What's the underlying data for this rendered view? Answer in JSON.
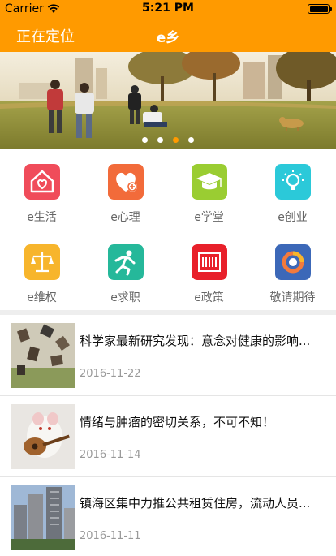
{
  "status_bar": {
    "carrier": "Carrier",
    "time": "5:21 PM",
    "battery_level": 1.0
  },
  "nav": {
    "location_label": "正在定位",
    "title": "e乡"
  },
  "banner": {
    "slide_count": 4,
    "active_slide": 2
  },
  "grid": {
    "items": [
      {
        "label": "e生活",
        "icon": "home-heart-icon",
        "color": "#F04C5A"
      },
      {
        "label": "e心理",
        "icon": "heart-plus-icon",
        "color": "#F26B3A"
      },
      {
        "label": "e学堂",
        "icon": "graduation-cap-icon",
        "color": "#9ACD32"
      },
      {
        "label": "e创业",
        "icon": "lightbulb-icon",
        "color": "#2BC9D9"
      },
      {
        "label": "e维权",
        "icon": "scales-icon",
        "color": "#F7B52C"
      },
      {
        "label": "e求职",
        "icon": "running-man-icon",
        "color": "#25B89A"
      },
      {
        "label": "e政策",
        "icon": "document-icon",
        "color": "#E8202A"
      },
      {
        "label": "敬请期待",
        "icon": "ring-icon",
        "color": "#3C68B8"
      }
    ]
  },
  "news": [
    {
      "title": "科学家最新研究发现：意念对健康的影响...",
      "date": "2016-11-22"
    },
    {
      "title": "情绪与肿瘤的密切关系，不可不知！",
      "date": "2016-11-14"
    },
    {
      "title": "镇海区集中力推公共租赁住房，流动人员...",
      "date": "2016-11-11"
    }
  ]
}
